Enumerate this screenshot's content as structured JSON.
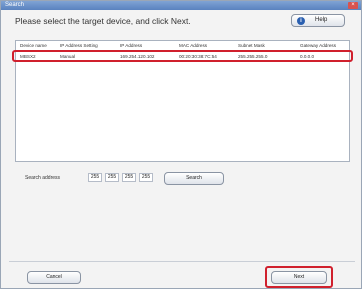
{
  "window": {
    "title": "Search"
  },
  "header": {
    "instruction": "Please select the target device, and click Next.",
    "help_label": "Help",
    "help_icon": "help-icon"
  },
  "table": {
    "columns": [
      "Device name",
      "IP Address Setting",
      "IP Address",
      "MAC Address",
      "Subnet Mask",
      "Gateway Address"
    ],
    "rows": [
      {
        "device_name": "MBSX2",
        "ip_setting": "Manual",
        "ip_address": "169.254.120.102",
        "mac": "00:20:30:38:7C:54",
        "subnet": "255.255.255.0",
        "gateway": "0.0.0.0"
      }
    ],
    "highlight_color": "#d0202d"
  },
  "search": {
    "label": "Search address",
    "octets": [
      "255",
      "255",
      "255",
      "255"
    ],
    "button_label": "Search"
  },
  "footer": {
    "cancel_label": "Cancel",
    "next_label": "Next"
  }
}
